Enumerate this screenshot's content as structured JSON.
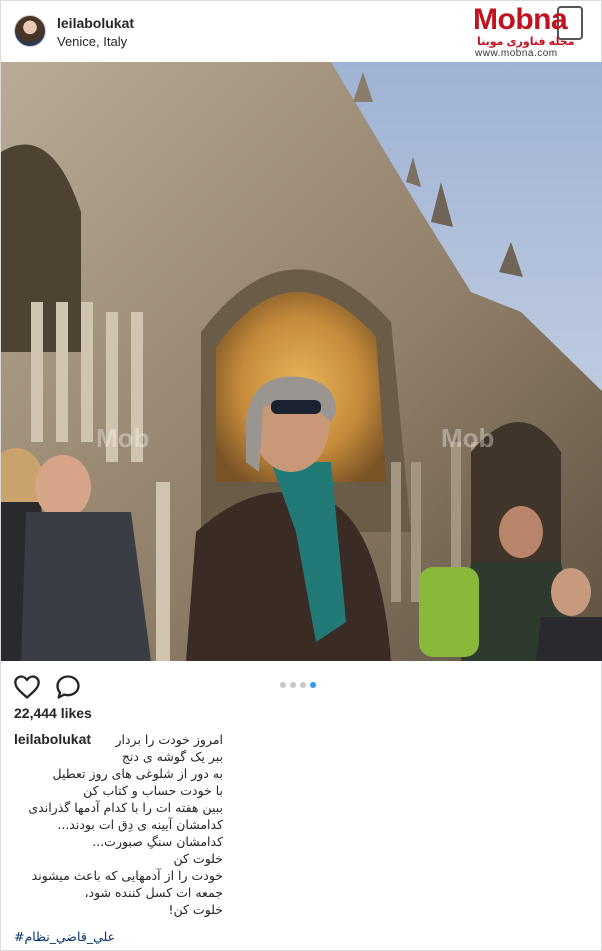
{
  "post": {
    "username": "leilabolukat",
    "location": "Venice, Italy",
    "likes": "22,444 likes"
  },
  "watermark": {
    "brand": "Mobna",
    "subtitle": "مجله فناوری موبنا",
    "url": "www.mobna.com"
  },
  "carousel": {
    "total": 4,
    "active_index": 3
  },
  "caption": {
    "username": "leilabolukat",
    "lines": [
      "امروز خودت را بردار",
      "ببر یک گوشه ی دنج",
      "به دور از شلوغی های روز تعطیل",
      "با خودت حساب و کتاب کن",
      "ببین هفته ات را با کدام آدمها گذراندی",
      "کدامشان آیینه ی دِق ات بودند...",
      "کدامشان سنگِ صبورت...",
      "خلوت کن",
      "خودت را از آدمهایی که باعث میشوند",
      "جمعه ات کسل کننده شود،",
      "خلوت کن!"
    ],
    "hashtag": "#علي_قاضي_نظام"
  },
  "colors": {
    "accent": "#3897f0",
    "hashtag": "#003569",
    "watermark_red": "#c1121f",
    "text": "#262626"
  },
  "icons": {
    "like": "heart-icon",
    "comment": "comment-bubble-icon"
  }
}
